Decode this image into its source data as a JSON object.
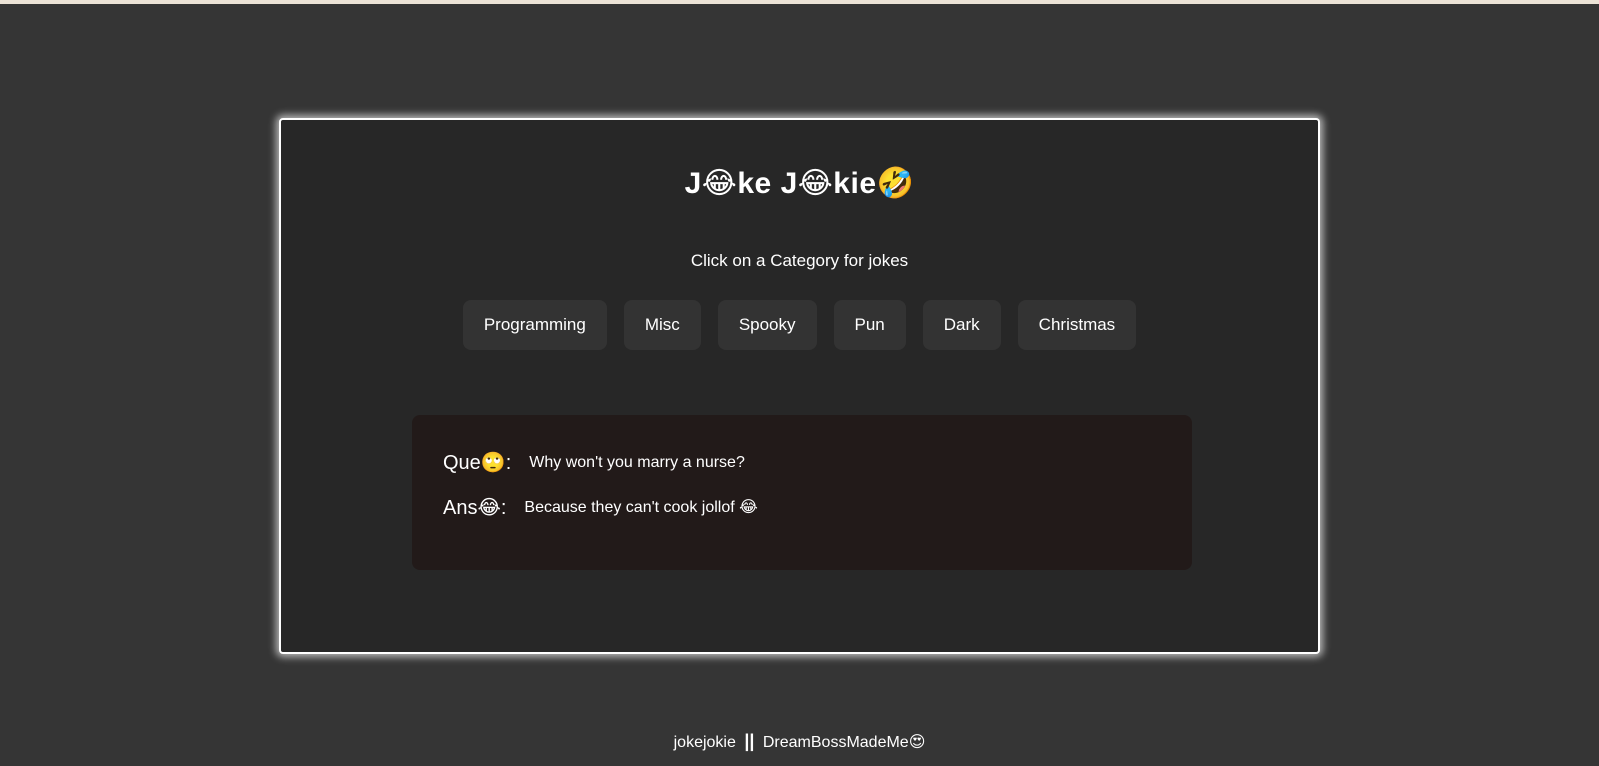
{
  "title": "J😂ke J😂kie🤣",
  "subtitle": "Click on a Category for jokes",
  "categories": [
    "Programming",
    "Misc",
    "Spooky",
    "Pun",
    "Dark",
    "Christmas"
  ],
  "joke": {
    "question_label": "Que🙄:",
    "question": "Why won't you marry a nurse?",
    "answer_label": "Ans😂:",
    "answer": "Because they can't cook jollof 😂"
  },
  "footer": {
    "left": "jokejokie",
    "separator": "||",
    "right": "DreamBossMadeMe😍"
  },
  "colors": {
    "page_background": "#353535",
    "card_background": "#272727",
    "button_background": "#333333",
    "joke_box_background": "#221a19"
  }
}
